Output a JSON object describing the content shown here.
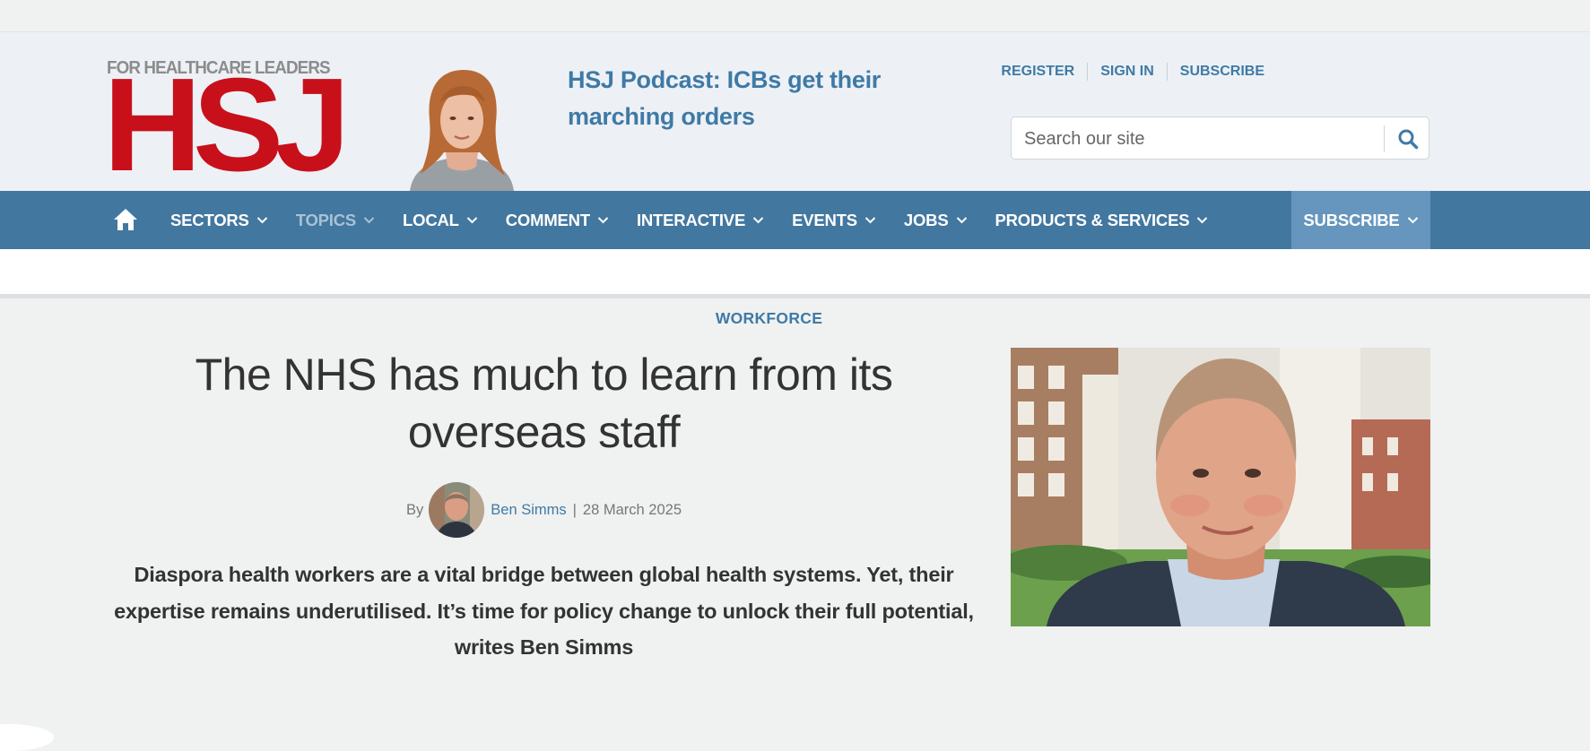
{
  "brand": {
    "tagline": "FOR HEALTHCARE LEADERS",
    "name": "HSJ",
    "accent_red": "#c8101b",
    "accent_blue": "#3f7aa6",
    "nav_blue": "#42779f"
  },
  "header": {
    "podcast_title": "HSJ Podcast: ICBs get their marching orders",
    "account_links": [
      "REGISTER",
      "SIGN IN",
      "SUBSCRIBE"
    ],
    "search_placeholder": "Search our site",
    "search_icon": "magnifier-icon"
  },
  "nav": {
    "home_icon": "home-icon",
    "items": [
      {
        "label": "SECTORS"
      },
      {
        "label": "TOPICS"
      },
      {
        "label": "LOCAL"
      },
      {
        "label": "COMMENT"
      },
      {
        "label": "INTERACTIVE"
      },
      {
        "label": "EVENTS"
      },
      {
        "label": "JOBS"
      },
      {
        "label": "PRODUCTS & SERVICES"
      }
    ],
    "subscribe": "SUBSCRIBE"
  },
  "article": {
    "section": "WORKFORCE",
    "headline": "The NHS has much to learn from its overseas staff",
    "by": "By",
    "author": "Ben Simms",
    "date": "28 March 2025",
    "standfirst": "Diaspora health workers are a vital bridge between global health systems. Yet, their expertise remains underutilised. It’s time for policy change to unlock their full potential, writes Ben Simms"
  }
}
